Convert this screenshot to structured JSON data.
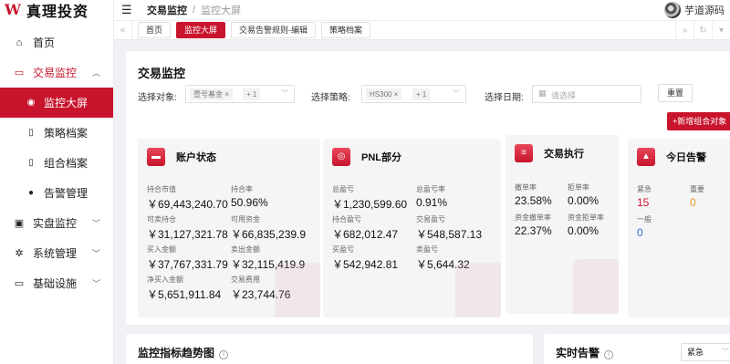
{
  "app": {
    "title": "真理投资"
  },
  "sidebar": {
    "items": [
      {
        "label": "首页",
        "icon": "home-icon"
      },
      {
        "label": "交易监控",
        "icon": "card-icon",
        "expanded": true,
        "children": [
          {
            "label": "监控大屏",
            "icon": "camera-icon",
            "active": true
          },
          {
            "label": "策略档案",
            "icon": "doc-icon"
          },
          {
            "label": "组合档案",
            "icon": "doc-icon"
          },
          {
            "label": "告警管理",
            "icon": "bell-icon"
          }
        ]
      },
      {
        "label": "实盘监控",
        "icon": "wallet-icon"
      },
      {
        "label": "系统管理",
        "icon": "gear-icon"
      },
      {
        "label": "基础设施",
        "icon": "monitor-icon"
      }
    ]
  },
  "topbar": {
    "breadcrumb_root": "交易监控",
    "breadcrumb_sep": "/",
    "breadcrumb_current": "监控大屏",
    "username": "芋道源码"
  },
  "tabs": [
    {
      "label": "首页",
      "active": false
    },
    {
      "label": "监控大屏",
      "active": true
    },
    {
      "label": "交易告警规则-编辑",
      "active": false
    },
    {
      "label": "策略档案",
      "active": false
    }
  ],
  "main": {
    "title": "交易监控",
    "filters": {
      "object_label": "选择对象:",
      "object_tag": "壹号基金",
      "object_more": "+ 1",
      "strategy_label": "选择策略:",
      "strategy_tag": "HS300",
      "strategy_more": "+ 1",
      "date_label": "选择日期:",
      "date_placeholder": "请选择"
    },
    "reset_label": "重置",
    "add_label": "+新增组合对象"
  },
  "cards": {
    "account": {
      "title": "账户状态",
      "fields": [
        {
          "k": "持合市值",
          "v": "￥69,443,240.70"
        },
        {
          "k": "持合率",
          "v": "50.96%"
        },
        {
          "k": "可卖持仓",
          "v": "￥31,127,321.78"
        },
        {
          "k": "可用资金",
          "v": "￥66,835,239.9"
        },
        {
          "k": "买入金额",
          "v": "￥37,767,331.79"
        },
        {
          "k": "卖出金额",
          "v": "￥32,115,419.9"
        },
        {
          "k": "净买入金额",
          "v": "￥5,651,911.84"
        },
        {
          "k": "交易费用",
          "v": "￥23,744.76"
        }
      ]
    },
    "pnl": {
      "title": "PNL部分",
      "fields": [
        {
          "k": "总盈亏",
          "v": "￥1,230,599.60"
        },
        {
          "k": "总盈亏率",
          "v": "0.91%"
        },
        {
          "k": "持合盈亏",
          "v": "￥682,012.47"
        },
        {
          "k": "交易盈亏",
          "v": "￥548,587.13"
        },
        {
          "k": "买盈亏",
          "v": "￥542,942.81"
        },
        {
          "k": "卖盈亏",
          "v": "￥5,644.32"
        }
      ]
    },
    "execution": {
      "title": "交易执行",
      "fields": [
        {
          "k": "撤单率",
          "v": "23.58%"
        },
        {
          "k": "拒单率",
          "v": "0.00%"
        },
        {
          "k": "资金撤单率",
          "v": "22.37%"
        },
        {
          "k": "资金拒单率",
          "v": "0.00%"
        }
      ]
    },
    "alerts": {
      "title": "今日告警",
      "fields": [
        {
          "k": "紧急",
          "v": "15"
        },
        {
          "k": "重要",
          "v": "0"
        },
        {
          "k": "一般",
          "v": "0"
        }
      ]
    }
  },
  "bottom": {
    "trend_title": "监控指标趋势图",
    "realtime_title": "实时告警",
    "realtime_filter": "紧急"
  },
  "colors": {
    "accent": "#c8142c",
    "urgent": "#c8142c",
    "important": "#e5962b",
    "normal": "#2a6fd6"
  }
}
